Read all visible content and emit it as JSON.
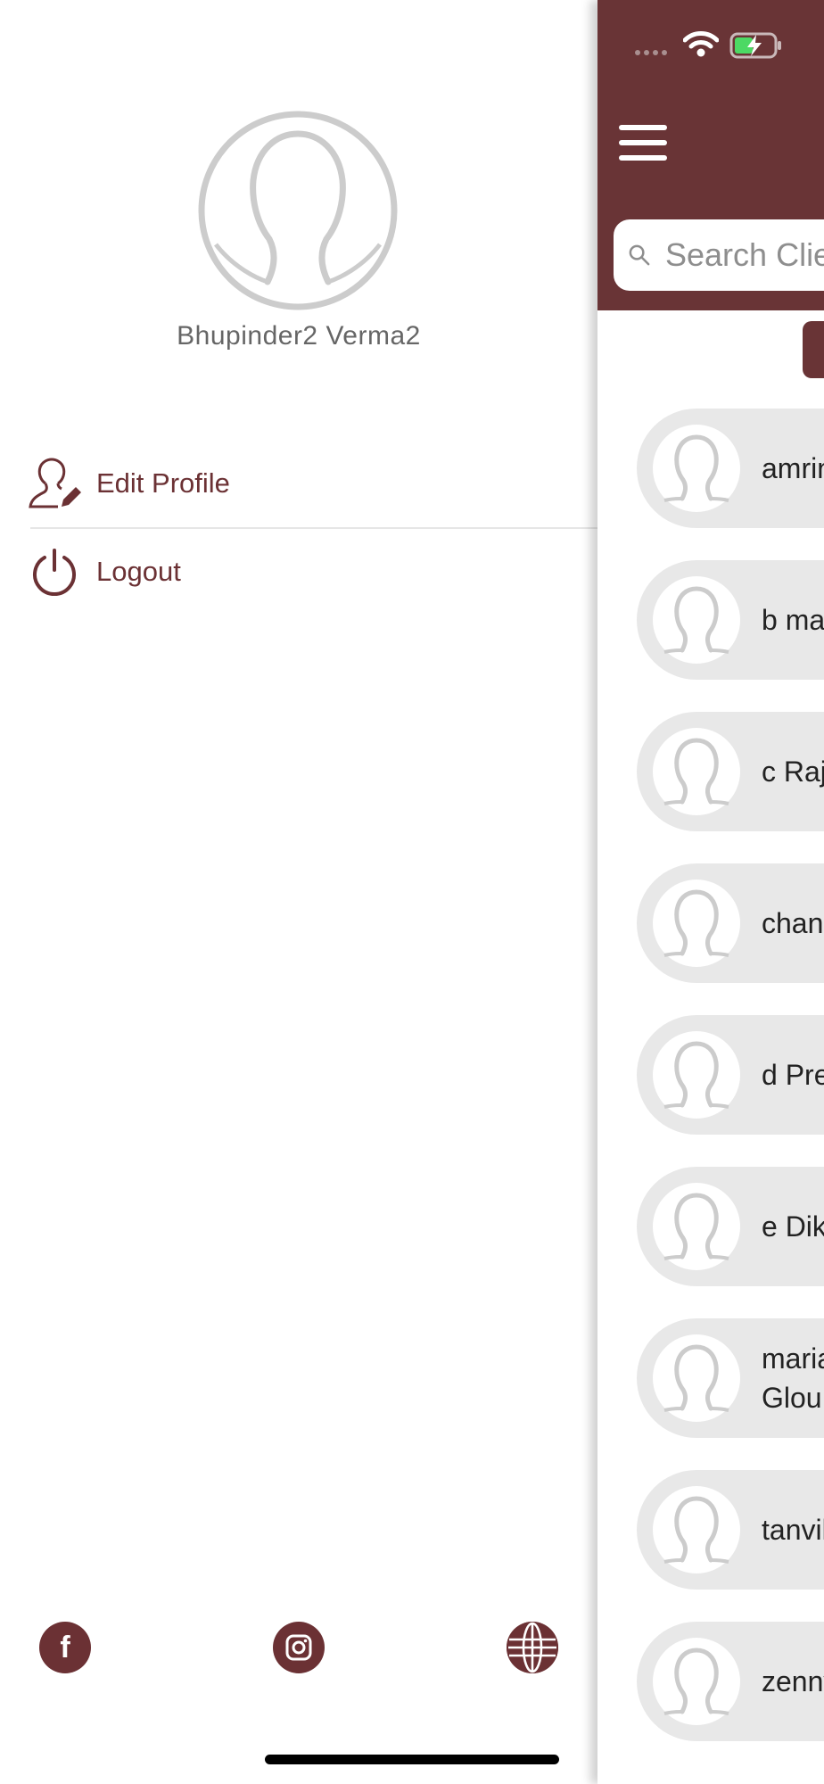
{
  "drawer": {
    "user_name": "Bhupinder2 Verma2",
    "menu": [
      {
        "label": "Edit Profile",
        "icon": "edit-profile-icon"
      },
      {
        "label": "Logout",
        "icon": "power-icon"
      }
    ],
    "social": [
      "facebook-icon",
      "instagram-icon",
      "globe-icon"
    ]
  },
  "main": {
    "search": {
      "placeholder": "Search Clients"
    },
    "clients": [
      {
        "name": "amrin"
      },
      {
        "name": "b ma"
      },
      {
        "name": "c Raj"
      },
      {
        "name": "chand"
      },
      {
        "name": "d Pre"
      },
      {
        "name": "e Dik"
      },
      {
        "name": "maria\nGlou"
      },
      {
        "name": "tanvil"
      },
      {
        "name": "zenny"
      }
    ]
  },
  "colors": {
    "brand": "#693436",
    "accent_text": "#6b3134",
    "card_bg": "#e8e8e8",
    "avatar_outline": "#c8c8c8"
  }
}
